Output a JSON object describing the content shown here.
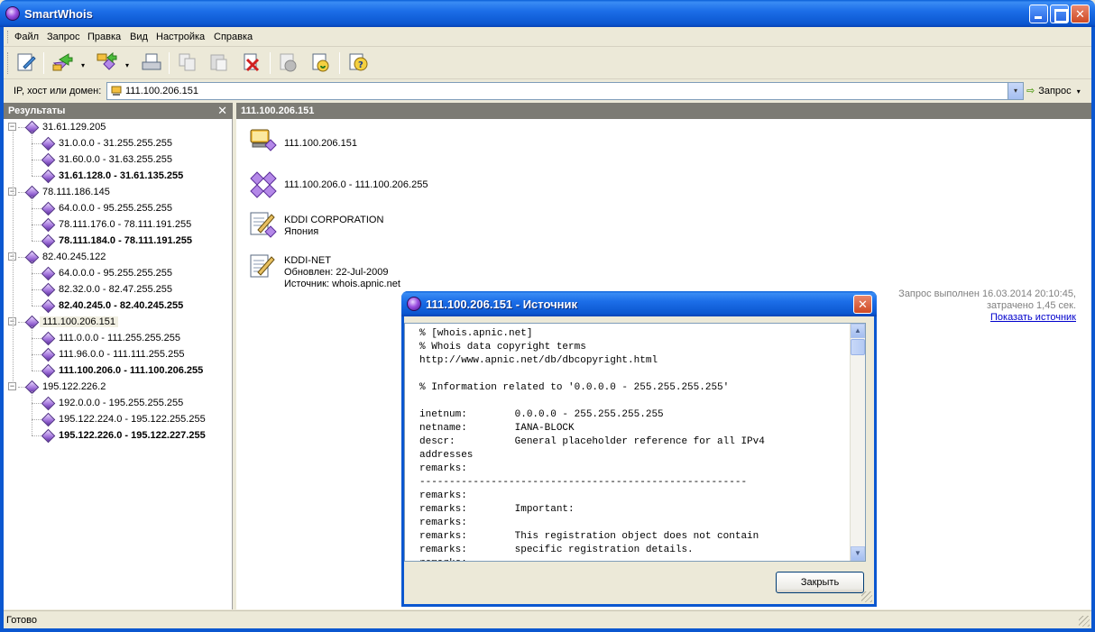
{
  "window": {
    "title": "SmartWhois",
    "min_icon": "minimize-icon",
    "max_icon": "maximize-icon",
    "close_label": "✕"
  },
  "menu": [
    "Файл",
    "Запрос",
    "Правка",
    "Вид",
    "Настройка",
    "Справка"
  ],
  "toolbar": {
    "icons": [
      "new-query-icon",
      "forward-icon",
      "batch-icon",
      "print-icon",
      "copy-icon",
      "paste-icon",
      "delete-icon",
      "info-icon",
      "refresh-icon",
      "help-icon"
    ],
    "dropdown_glyph": "▾"
  },
  "address": {
    "label": "IP, хост или домен:",
    "value": "111.100.206.151",
    "query_label": "Запрос",
    "query_arrow": "⇨",
    "dropdown_glyph": "▾"
  },
  "results": {
    "title": "Результаты",
    "close_glyph": "✕",
    "tree": [
      {
        "label": "31.61.129.205",
        "children": [
          {
            "label": "31.0.0.0 - 31.255.255.255",
            "bold": false
          },
          {
            "label": "31.60.0.0 - 31.63.255.255",
            "bold": false
          },
          {
            "label": "31.61.128.0 - 31.61.135.255",
            "bold": true
          }
        ]
      },
      {
        "label": "78.111.186.145",
        "children": [
          {
            "label": "64.0.0.0 - 95.255.255.255",
            "bold": false
          },
          {
            "label": "78.111.176.0 - 78.111.191.255",
            "bold": false
          },
          {
            "label": "78.111.184.0 - 78.111.191.255",
            "bold": true
          }
        ]
      },
      {
        "label": "82.40.245.122",
        "children": [
          {
            "label": "64.0.0.0 - 95.255.255.255",
            "bold": false
          },
          {
            "label": "82.32.0.0 - 82.47.255.255",
            "bold": false
          },
          {
            "label": "82.40.245.0 - 82.40.245.255",
            "bold": true
          }
        ]
      },
      {
        "label": "111.100.206.151",
        "selected": true,
        "children": [
          {
            "label": "111.0.0.0 - 111.255.255.255",
            "bold": false
          },
          {
            "label": "111.96.0.0 - 111.111.255.255",
            "bold": false
          },
          {
            "label": "111.100.206.0 - 111.100.206.255",
            "bold": true
          }
        ]
      },
      {
        "label": "195.122.226.2",
        "children": [
          {
            "label": "192.0.0.0 - 195.255.255.255",
            "bold": false
          },
          {
            "label": "195.122.224.0 - 195.122.255.255",
            "bold": false
          },
          {
            "label": "195.122.226.0 - 195.122.227.255",
            "bold": true
          }
        ]
      }
    ]
  },
  "detail": {
    "header": "111.100.206.151",
    "host": "111.100.206.151",
    "range": "111.100.206.0 - 111.100.206.255",
    "org_name": "KDDI CORPORATION",
    "org_country": "Япония",
    "net_name": "KDDI-NET",
    "net_updated": "Обновлен: 22-Jul-2009",
    "net_source": "Источник: whois.apnic.net",
    "query_info_1": "Запрос выполнен 16.03.2014 20:10:45,",
    "query_info_2": "затрачено 1,45 сек.",
    "show_source": "Показать источник"
  },
  "status": {
    "text": "Готово"
  },
  "dialog": {
    "title": "111.100.206.151 - Источник",
    "close_glyph": "✕",
    "close_button": "Закрыть",
    "scroll_up": "▲",
    "scroll_down": "▼",
    "source_lines": [
      "% [whois.apnic.net]",
      "% Whois data copyright terms",
      "http://www.apnic.net/db/dbcopyright.html",
      "",
      "% Information related to '0.0.0.0 - 255.255.255.255'",
      "",
      "inetnum:        0.0.0.0 - 255.255.255.255",
      "netname:        IANA-BLOCK",
      "descr:          General placeholder reference for all IPv4",
      "addresses",
      "remarks:",
      "-------------------------------------------------------",
      "remarks:",
      "remarks:        Important:",
      "remarks:",
      "remarks:        This registration object does not contain",
      "remarks:        specific registration details.",
      "remarks:"
    ]
  }
}
